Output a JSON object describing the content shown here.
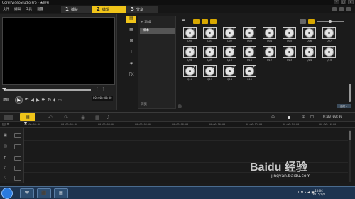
{
  "window": {
    "title": "Corel VideoStudio Pro - 未命名",
    "controls": [
      "–",
      "□",
      "×"
    ]
  },
  "menu": {
    "items": [
      "文件",
      "编辑",
      "工具",
      "设置"
    ]
  },
  "steps": [
    {
      "num": "1",
      "label": "捕获"
    },
    {
      "num": "2",
      "label": "编辑"
    },
    {
      "num": "3",
      "label": "分享"
    }
  ],
  "player": {
    "mode_project": "项目",
    "mode_clip": "素材",
    "play_icon": "▶",
    "timecode": "00:00:00:00",
    "trim_marks": "[ ]"
  },
  "library": {
    "tabs": [
      "media",
      "instant-project",
      "transition",
      "title",
      "graphic",
      "filter"
    ],
    "fx_label": "FX",
    "title_label": "T",
    "add_label": "+ 添加",
    "folder_sample": "样本",
    "browse_label": "浏览",
    "thumbs": [
      {
        "label": "Q00"
      },
      {
        "label": "Q01"
      },
      {
        "label": "Q02"
      },
      {
        "label": "Q03"
      },
      {
        "label": "Q04"
      },
      {
        "label": "Q05"
      },
      {
        "label": "Q06"
      },
      {
        "label": "Q07"
      },
      {
        "label": "Q08"
      },
      {
        "label": "Q09"
      },
      {
        "label": "Q10"
      },
      {
        "label": "Q11"
      },
      {
        "label": "Q12"
      },
      {
        "label": "Q13"
      },
      {
        "label": "Q14"
      },
      {
        "label": "Q15"
      },
      {
        "label": "Q16"
      },
      {
        "label": "Q17"
      },
      {
        "label": "Q18"
      },
      {
        "label": "Q19"
      }
    ],
    "options_label": "选项 ▾"
  },
  "timeline": {
    "time": "0:00:00:00",
    "ruler": [
      "00:00:00:00",
      "00:00:02:00",
      "00:00:04:00",
      "00:00:06:00",
      "00:00:08:00",
      "00:00:10:00",
      "00:00:12:00",
      "00:00:14:00",
      "00:00:16:00"
    ],
    "tracks": [
      {
        "icon": "▣"
      },
      {
        "icon": "▤"
      },
      {
        "icon": "T"
      },
      {
        "icon": "♪"
      },
      {
        "icon": "♫"
      }
    ]
  },
  "taskbar": {
    "apps": [
      "W",
      "⬛",
      "▤"
    ],
    "tray": "CH ▴ ◀ ▣",
    "time": "10:06",
    "date": "2015/1/8"
  },
  "watermark": {
    "brand": "Baidu 经验",
    "url": "jingyan.baidu.com"
  }
}
